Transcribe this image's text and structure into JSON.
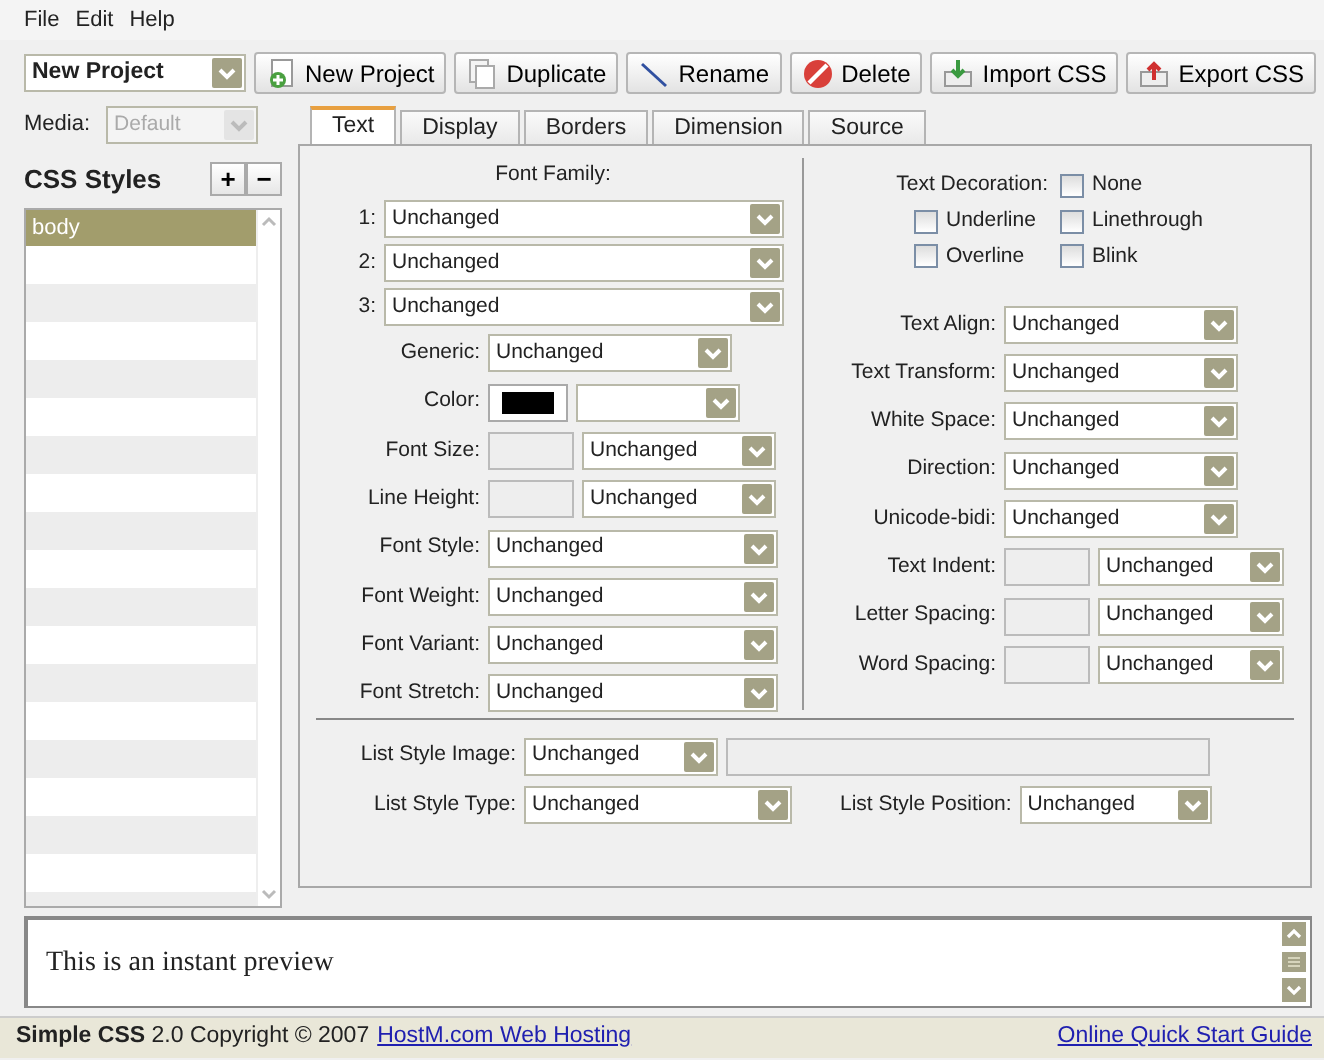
{
  "menu": [
    {
      "label": "File"
    },
    {
      "label": "Edit"
    },
    {
      "label": "Help"
    }
  ],
  "project": {
    "value": "New Project"
  },
  "toolbar": [
    {
      "label": "New Project",
      "kind": "new"
    },
    {
      "label": "Duplicate",
      "kind": "copy"
    },
    {
      "label": "Rename",
      "kind": "rename"
    },
    {
      "label": "Delete",
      "kind": "delete"
    },
    {
      "label": "Import CSS",
      "kind": "import"
    },
    {
      "label": "Export CSS",
      "kind": "export"
    }
  ],
  "media": {
    "label": "Media:",
    "value": "Default",
    "disabled": true
  },
  "styles": {
    "title": "CSS Styles",
    "add": "+",
    "remove": "−",
    "items": [
      {
        "label": "body",
        "selected": true
      }
    ]
  },
  "tabs": [
    {
      "label": "Text",
      "selected": true
    },
    {
      "label": "Display",
      "selected": false
    },
    {
      "label": "Borders",
      "selected": false
    },
    {
      "label": "Dimension",
      "selected": false
    },
    {
      "label": "Source",
      "selected": false
    }
  ],
  "font_family": {
    "title": "Font Family:",
    "rows": [
      {
        "label": "1:",
        "value": "Unchanged"
      },
      {
        "label": "2:",
        "value": "Unchanged"
      },
      {
        "label": "3:",
        "value": "Unchanged"
      }
    ]
  },
  "left_fields": [
    {
      "label": "Generic:",
      "kind": "short_select",
      "value": "Unchanged"
    },
    {
      "label": "Color:",
      "kind": "color"
    },
    {
      "label": "Font Size:",
      "kind": "measure",
      "value": "Unchanged"
    },
    {
      "label": "Line Height:",
      "kind": "measure",
      "value": "Unchanged"
    },
    {
      "label": "Font Style:",
      "kind": "select",
      "value": "Unchanged"
    },
    {
      "label": "Font Weight:",
      "kind": "select",
      "value": "Unchanged"
    },
    {
      "label": "Font Variant:",
      "kind": "select",
      "value": "Unchanged"
    },
    {
      "label": "Font Stretch:",
      "kind": "select",
      "value": "Unchanged"
    }
  ],
  "text_decoration": {
    "label": "Text Decoration:",
    "options": [
      {
        "label": "None",
        "checked": false
      },
      {
        "label": "Underline",
        "checked": false
      },
      {
        "label": "Linethrough",
        "checked": false
      },
      {
        "label": "Overline",
        "checked": false
      },
      {
        "label": "Blink",
        "checked": false
      }
    ]
  },
  "right_fields": [
    {
      "label": "Text Align:",
      "kind": "select",
      "value": "Unchanged"
    },
    {
      "label": "Text Transform:",
      "kind": "select",
      "value": "Unchanged"
    },
    {
      "label": "White Space:",
      "kind": "select",
      "value": "Unchanged"
    },
    {
      "label": "Direction:",
      "kind": "select",
      "value": "Unchanged"
    },
    {
      "label": "Unicode-bidi:",
      "kind": "select",
      "value": "Unchanged"
    },
    {
      "label": "Text Indent:",
      "kind": "measure",
      "value": "Unchanged"
    },
    {
      "label": "Letter Spacing:",
      "kind": "measure",
      "value": "Unchanged"
    },
    {
      "label": "Word Spacing:",
      "kind": "measure",
      "value": "Unchanged"
    }
  ],
  "list_style": {
    "image": {
      "label": "List Style Image:",
      "value": "Unchanged"
    },
    "type": {
      "label": "List Style Type:",
      "value": "Unchanged"
    },
    "position": {
      "label": "List Style Position:",
      "value": "Unchanged"
    }
  },
  "preview": {
    "text": "This is an instant preview"
  },
  "status_bar": {
    "text": "**Simple CSS** 2.0 Copyright © 2007",
    "link": "HostM.com Web Hosting",
    "guide": "Online Quick Start Guide"
  }
}
